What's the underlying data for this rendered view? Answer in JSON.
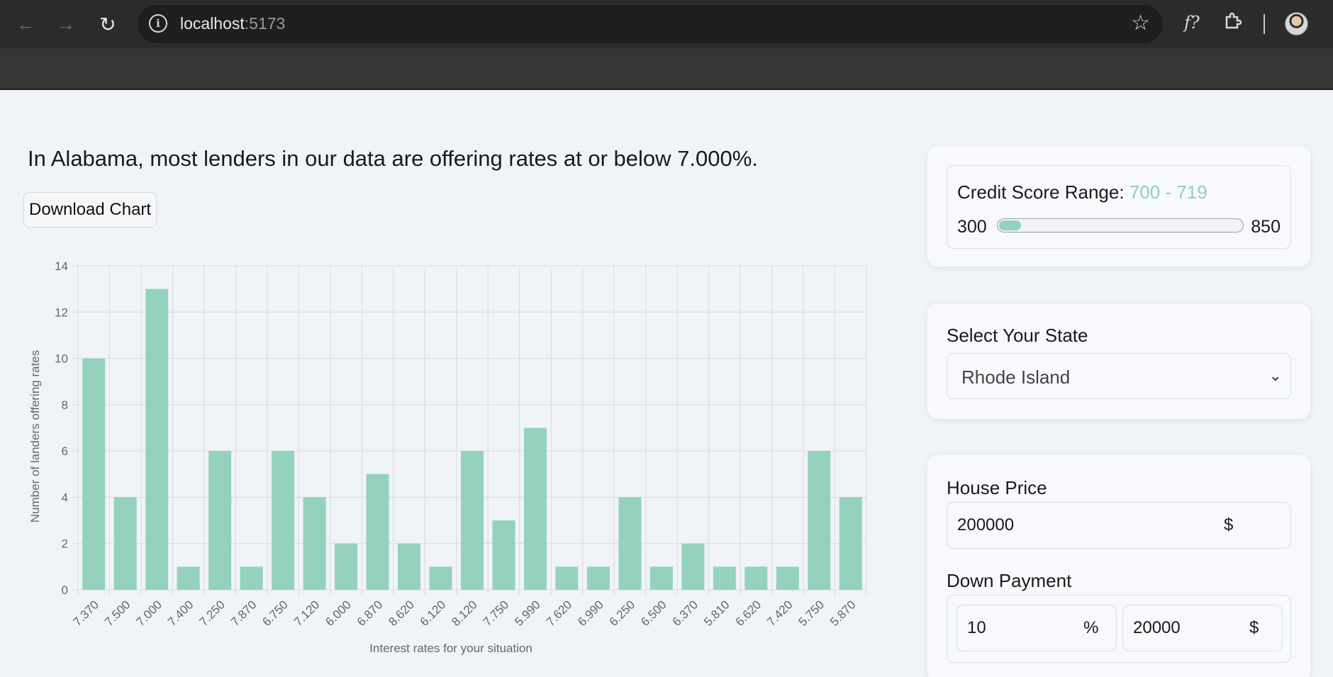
{
  "browser": {
    "url_host": "localhost",
    "url_port": ":5173",
    "back_icon": "arrow-left-icon",
    "forward_icon": "arrow-right-icon",
    "reload_icon": "reload-icon",
    "info_icon": "info-icon",
    "bookmark_icon": "star-icon",
    "ext1_icon": "fx-icon",
    "ext2_icon": "puzzle-icon"
  },
  "main": {
    "headline": "In Alabama, most lenders in our data are offering rates at or below 7.000%.",
    "download_label": "Download Chart"
  },
  "chart_data": {
    "type": "bar",
    "categories": [
      "7.370",
      "7.500",
      "7.000",
      "7.400",
      "7.250",
      "7.870",
      "6.750",
      "7.120",
      "6.000",
      "6.870",
      "8.620",
      "6.120",
      "8.120",
      "7.750",
      "5.990",
      "7.620",
      "6.990",
      "6.250",
      "6.500",
      "6.370",
      "5.810",
      "6.620",
      "7.420",
      "5.750",
      "5.870"
    ],
    "values": [
      10,
      4,
      13,
      1,
      6,
      1,
      6,
      4,
      2,
      5,
      2,
      1,
      6,
      3,
      7,
      1,
      1,
      4,
      1,
      2,
      1,
      1,
      1,
      6,
      4
    ],
    "xlabel": "Interest rates for your situation",
    "ylabel": "Number of landers offering rates",
    "ylim": [
      0,
      14
    ],
    "yticks": [
      0,
      2,
      4,
      6,
      8,
      10,
      12,
      14
    ],
    "grid": true,
    "bar_color": "#94d2bd"
  },
  "sidebar": {
    "credit": {
      "label": "Credit Score Range: ",
      "range": "700 - 719",
      "min": "300",
      "max": "850",
      "level_fraction": 0.09
    },
    "state": {
      "label": "Select Your State",
      "value": "Rhode Island"
    },
    "house": {
      "label": "House Price",
      "value": "200000",
      "unit": "$"
    },
    "down": {
      "label": "Down Payment",
      "percent_value": "10",
      "percent_unit": "%",
      "amount_value": "20000",
      "amount_unit": "$"
    }
  },
  "colors": {
    "accent": "#94d2bd",
    "background": "#f0f3f8"
  }
}
